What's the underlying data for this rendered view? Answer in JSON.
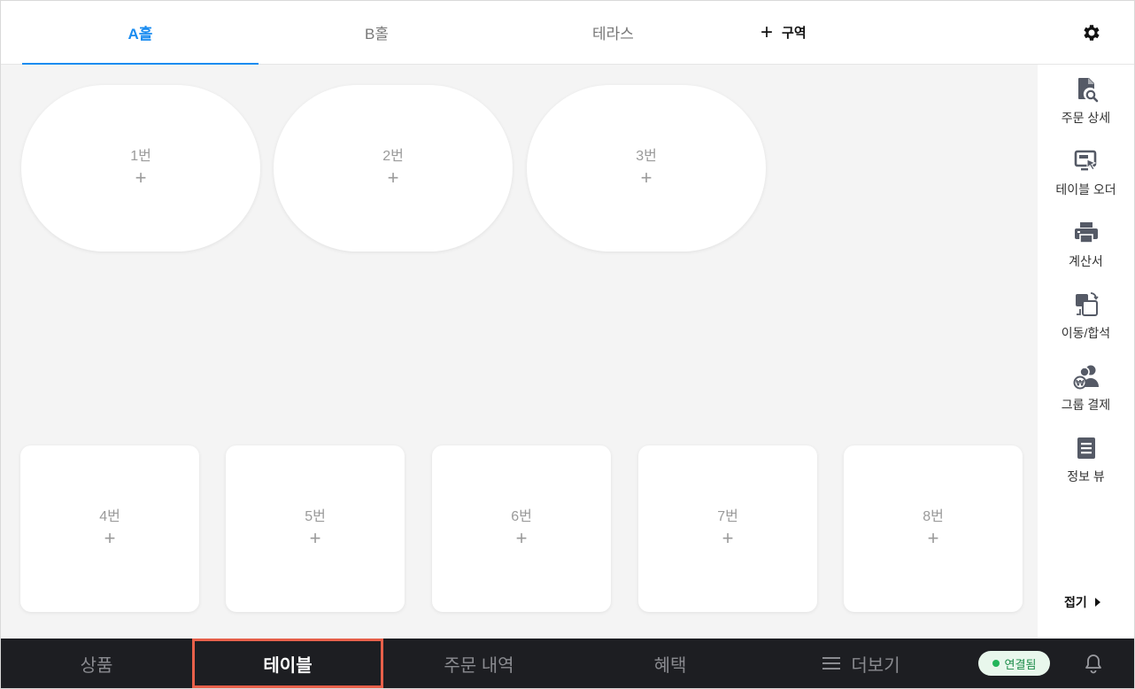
{
  "top_tabs": [
    {
      "label": "A홀",
      "active": true
    },
    {
      "label": "B홀",
      "active": false
    },
    {
      "label": "테라스",
      "active": false
    }
  ],
  "add_zone": {
    "icon": "plus-icon",
    "label": "구역"
  },
  "settings_icon": "gear-icon",
  "tables_oval": [
    {
      "name": "1번",
      "add": "+"
    },
    {
      "name": "2번",
      "add": "+"
    },
    {
      "name": "3번",
      "add": "+"
    }
  ],
  "tables_rect": [
    {
      "name": "4번",
      "add": "+"
    },
    {
      "name": "5번",
      "add": "+"
    },
    {
      "name": "6번",
      "add": "+"
    },
    {
      "name": "7번",
      "add": "+"
    },
    {
      "name": "8번",
      "add": "+"
    }
  ],
  "sidebar": {
    "items": [
      {
        "label": "주문 상세",
        "icon": "order-detail-icon"
      },
      {
        "label": "테이블 오더",
        "icon": "table-order-icon"
      },
      {
        "label": "계산서",
        "icon": "printer-icon"
      },
      {
        "label": "이동/합석",
        "icon": "move-merge-icon"
      },
      {
        "label": "그룹 결제",
        "icon": "group-payment-icon"
      },
      {
        "label": "정보 뷰",
        "icon": "info-view-icon"
      }
    ],
    "collapse_label": "접기",
    "collapse_icon": "caret-right-icon"
  },
  "bottom_nav": {
    "items": [
      {
        "label": "상품",
        "active": false
      },
      {
        "label": "테이블",
        "active": true
      },
      {
        "label": "주문 내역",
        "active": false
      },
      {
        "label": "혜택",
        "active": false
      },
      {
        "label": "더보기",
        "active": false,
        "icon": "menu-icon"
      }
    ],
    "connection_status": "연결됨",
    "bell_icon": "bell-icon"
  },
  "colors": {
    "accent": "#1a8cf0",
    "nav_bg": "#1d1e22",
    "highlight": "#e8604a",
    "connected": "#22b55a"
  }
}
